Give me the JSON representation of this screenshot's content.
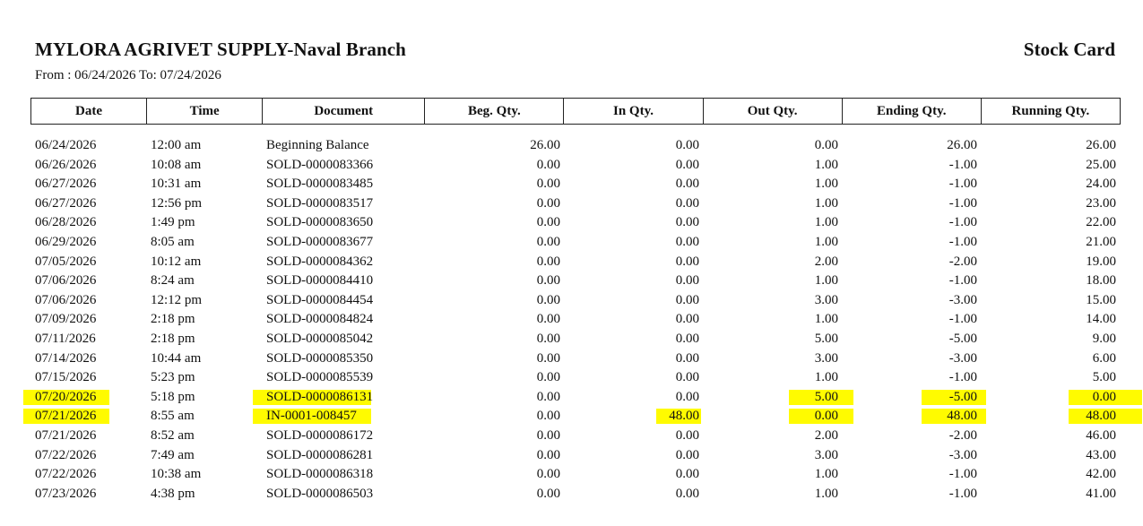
{
  "header": {
    "company": "MYLORA AGRIVET SUPPLY-Naval Branch",
    "report_title": "Stock Card",
    "period": "From : 06/24/2026 To: 07/24/2026"
  },
  "columns": [
    "Date",
    "Time",
    "Document",
    "Beg. Qty.",
    "In Qty.",
    "Out Qty.",
    "Ending Qty.",
    "Running Qty."
  ],
  "highlight_color": "#fffb00",
  "rows": [
    {
      "date": "06/24/2026",
      "time": "12:00 am",
      "document": "Beginning Balance",
      "beg": "26.00",
      "in": "0.00",
      "out": "0.00",
      "ending": "26.00",
      "running": "26.00"
    },
    {
      "date": "06/26/2026",
      "time": "10:08 am",
      "document": "SOLD-0000083366",
      "beg": "0.00",
      "in": "0.00",
      "out": "1.00",
      "ending": "-1.00",
      "running": "25.00"
    },
    {
      "date": "06/27/2026",
      "time": "10:31 am",
      "document": "SOLD-0000083485",
      "beg": "0.00",
      "in": "0.00",
      "out": "1.00",
      "ending": "-1.00",
      "running": "24.00"
    },
    {
      "date": "06/27/2026",
      "time": "12:56 pm",
      "document": "SOLD-0000083517",
      "beg": "0.00",
      "in": "0.00",
      "out": "1.00",
      "ending": "-1.00",
      "running": "23.00"
    },
    {
      "date": "06/28/2026",
      "time": "1:49 pm",
      "document": "SOLD-0000083650",
      "beg": "0.00",
      "in": "0.00",
      "out": "1.00",
      "ending": "-1.00",
      "running": "22.00"
    },
    {
      "date": "06/29/2026",
      "time": "8:05 am",
      "document": "SOLD-0000083677",
      "beg": "0.00",
      "in": "0.00",
      "out": "1.00",
      "ending": "-1.00",
      "running": "21.00"
    },
    {
      "date": "07/05/2026",
      "time": "10:12 am",
      "document": "SOLD-0000084362",
      "beg": "0.00",
      "in": "0.00",
      "out": "2.00",
      "ending": "-2.00",
      "running": "19.00"
    },
    {
      "date": "07/06/2026",
      "time": "8:24 am",
      "document": "SOLD-0000084410",
      "beg": "0.00",
      "in": "0.00",
      "out": "1.00",
      "ending": "-1.00",
      "running": "18.00"
    },
    {
      "date": "07/06/2026",
      "time": "12:12 pm",
      "document": "SOLD-0000084454",
      "beg": "0.00",
      "in": "0.00",
      "out": "3.00",
      "ending": "-3.00",
      "running": "15.00"
    },
    {
      "date": "07/09/2026",
      "time": "2:18 pm",
      "document": "SOLD-0000084824",
      "beg": "0.00",
      "in": "0.00",
      "out": "1.00",
      "ending": "-1.00",
      "running": "14.00"
    },
    {
      "date": "07/11/2026",
      "time": "2:18 pm",
      "document": "SOLD-0000085042",
      "beg": "0.00",
      "in": "0.00",
      "out": "5.00",
      "ending": "-5.00",
      "running": "9.00"
    },
    {
      "date": "07/14/2026",
      "time": "10:44 am",
      "document": "SOLD-0000085350",
      "beg": "0.00",
      "in": "0.00",
      "out": "3.00",
      "ending": "-3.00",
      "running": "6.00"
    },
    {
      "date": "07/15/2026",
      "time": "5:23 pm",
      "document": "SOLD-0000085539",
      "beg": "0.00",
      "in": "0.00",
      "out": "1.00",
      "ending": "-1.00",
      "running": "5.00"
    },
    {
      "date": "07/20/2026",
      "time": "5:18 pm",
      "document": "SOLD-0000086131",
      "beg": "0.00",
      "in": "0.00",
      "out": "5.00",
      "ending": "-5.00",
      "running": "0.00",
      "highlighted": [
        "date",
        "document",
        "out",
        "ending",
        "running"
      ]
    },
    {
      "date": "07/21/2026",
      "time": "8:55 am",
      "document": "IN-0001-008457",
      "beg": "0.00",
      "in": "48.00",
      "out": "0.00",
      "ending": "48.00",
      "running": "48.00",
      "highlighted": [
        "date",
        "document",
        "in",
        "out",
        "ending",
        "running"
      ]
    },
    {
      "date": "07/21/2026",
      "time": "8:52 am",
      "document": "SOLD-0000086172",
      "beg": "0.00",
      "in": "0.00",
      "out": "2.00",
      "ending": "-2.00",
      "running": "46.00"
    },
    {
      "date": "07/22/2026",
      "time": "7:49 am",
      "document": "SOLD-0000086281",
      "beg": "0.00",
      "in": "0.00",
      "out": "3.00",
      "ending": "-3.00",
      "running": "43.00"
    },
    {
      "date": "07/22/2026",
      "time": "10:38 am",
      "document": "SOLD-0000086318",
      "beg": "0.00",
      "in": "0.00",
      "out": "1.00",
      "ending": "-1.00",
      "running": "42.00"
    },
    {
      "date": "07/23/2026",
      "time": "4:38 pm",
      "document": "SOLD-0000086503",
      "beg": "0.00",
      "in": "0.00",
      "out": "1.00",
      "ending": "-1.00",
      "running": "41.00"
    }
  ]
}
